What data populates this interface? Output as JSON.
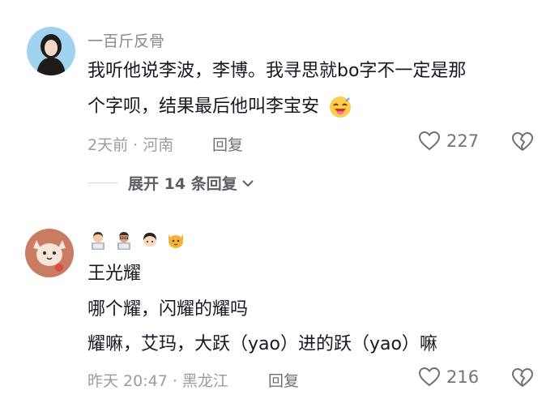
{
  "comments": [
    {
      "username": "一百斤反骨",
      "line1": "我听他说李波，李博。我寻思就bo字不一定是那",
      "line2": "个字呗，结果最后他叫李宝安",
      "time_location": "2天前 · 河南",
      "reply_label": "回复",
      "likes": "227",
      "expand_label": "展开 14 条回复"
    },
    {
      "badges": [
        "woman-laptop-emoji",
        "man-laptop-emoji",
        "girl-emoji",
        "cat-emoji"
      ],
      "line1": "王光耀",
      "line2": "哪个耀，闪耀的耀吗",
      "line3": "耀嘛，艾玛，大跃（yao）进的跃（yao）嘛",
      "time_location": "昨天 20:47 · 黑龙江",
      "reply_label": "回复",
      "likes": "216"
    }
  ],
  "colors": {
    "text": "#161823",
    "muted": "#9b9ca1",
    "username": "#8a8b91"
  }
}
